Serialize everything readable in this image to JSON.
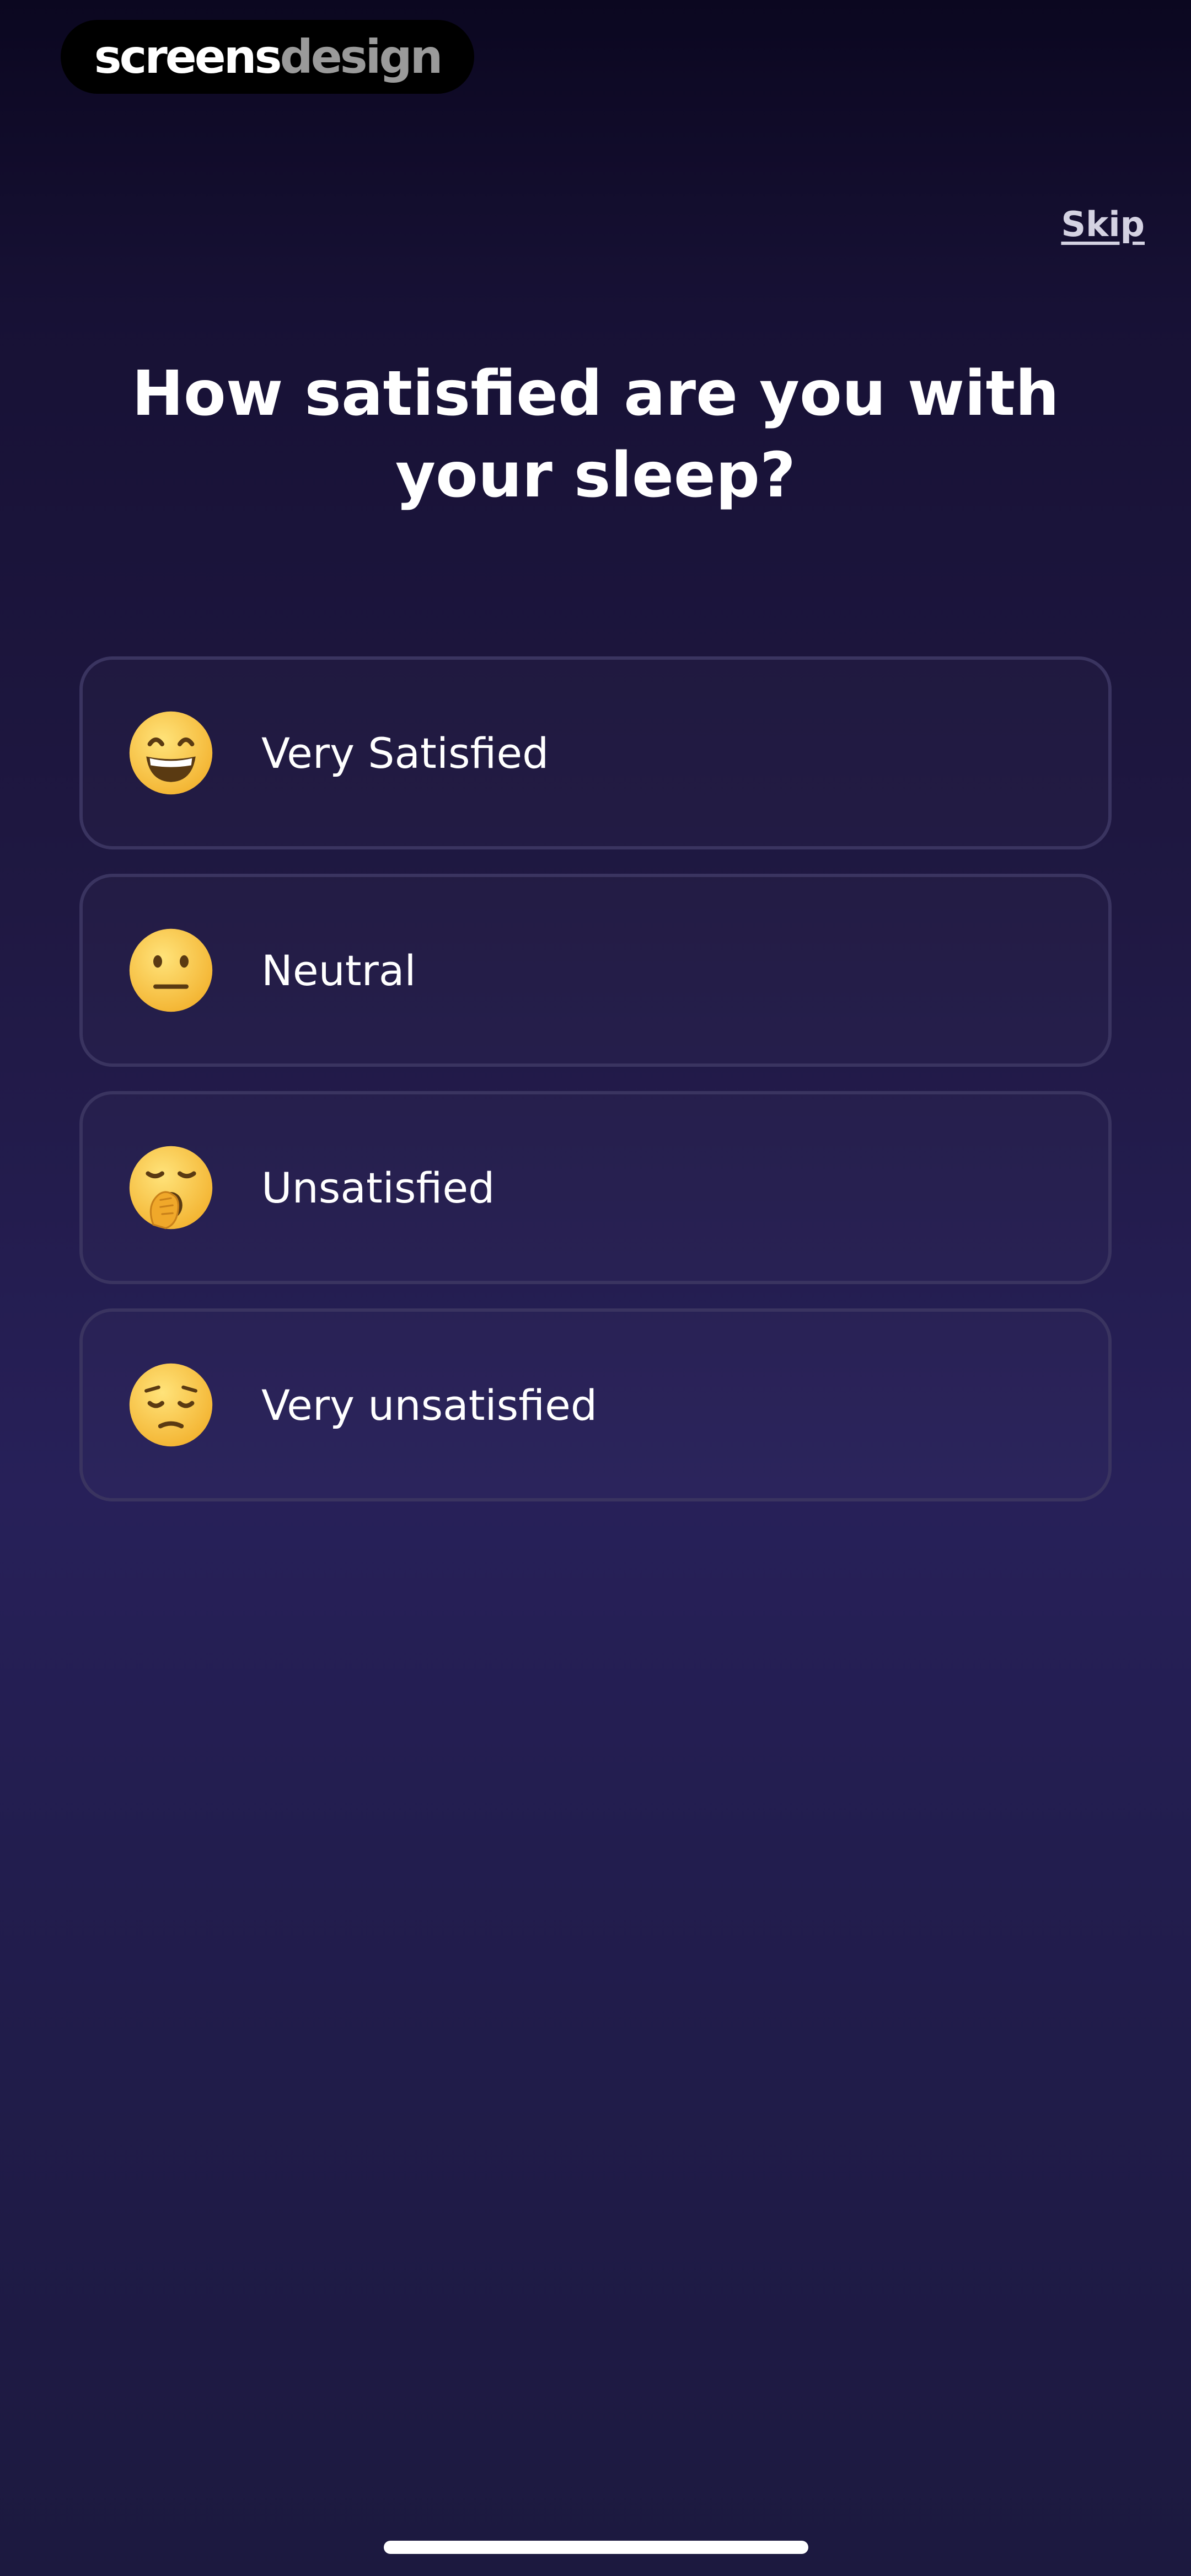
{
  "watermark": {
    "part1": "screens",
    "part2": "design"
  },
  "header": {
    "skip_label": "Skip"
  },
  "question": {
    "title": "How satisfied are you with your sleep?"
  },
  "options": [
    {
      "label": "Very Satisfied",
      "icon": "grinning-face-icon"
    },
    {
      "label": "Neutral",
      "icon": "neutral-face-icon"
    },
    {
      "label": "Unsatisfied",
      "icon": "yawning-face-icon"
    },
    {
      "label": "Very unsatisfied",
      "icon": "pensive-face-icon"
    }
  ],
  "colors": {
    "background_top": "#0b0720",
    "background_mid": "#272059",
    "option_border": "#3a3460",
    "emoji_yellow": "#f7c43a",
    "text": "#ffffff"
  }
}
